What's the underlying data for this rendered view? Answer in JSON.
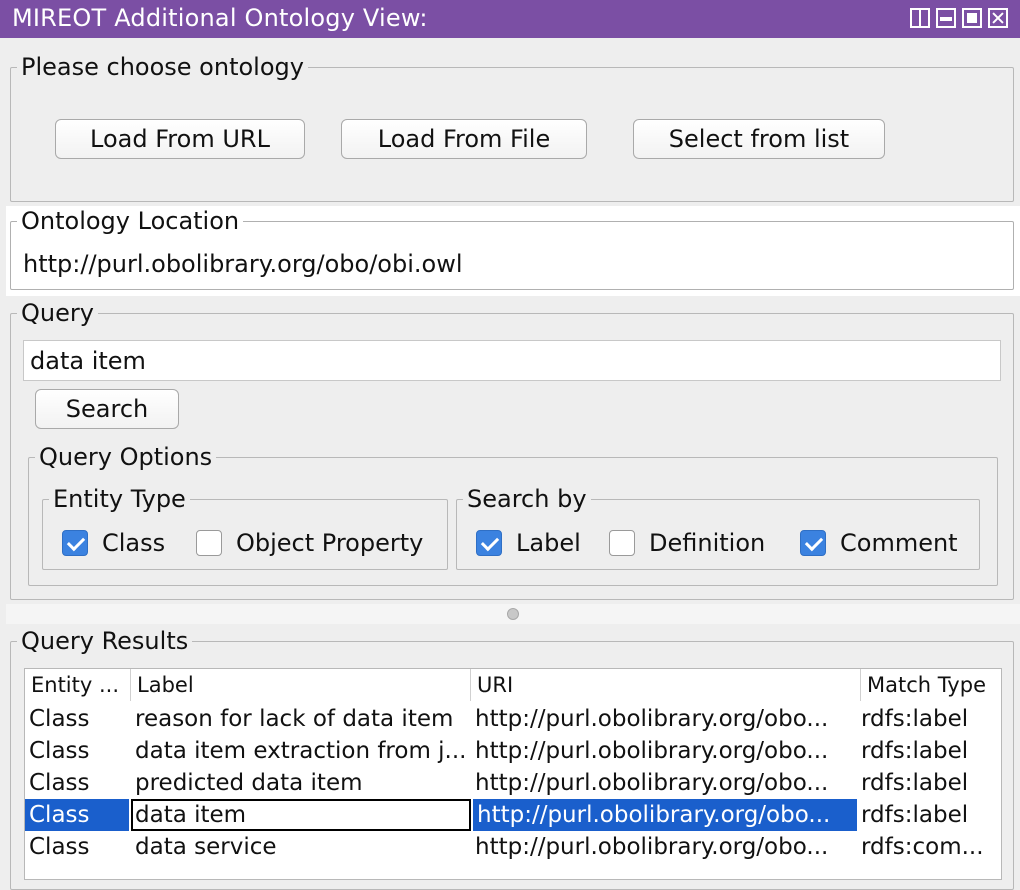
{
  "window": {
    "title": "MIREOT Additional Ontology View:",
    "controls": [
      "split-icon",
      "minimize-icon",
      "maximize-icon",
      "close-icon"
    ]
  },
  "choose": {
    "legend": "Please choose ontology",
    "buttons": [
      "Load From URL",
      "Load From File",
      "Select from list"
    ]
  },
  "location": {
    "legend": "Ontology Location",
    "value": "http://purl.obolibrary.org/obo/obi.owl"
  },
  "query": {
    "legend": "Query",
    "value": "data item",
    "search_label": "Search",
    "options_legend": "Query Options",
    "entity_type": {
      "legend": "Entity Type",
      "options": [
        {
          "label": "Class",
          "checked": true
        },
        {
          "label": "Object Property",
          "checked": false
        }
      ]
    },
    "search_by": {
      "legend": "Search by",
      "options": [
        {
          "label": "Label",
          "checked": true
        },
        {
          "label": "Definition",
          "checked": false
        },
        {
          "label": "Comment",
          "checked": true
        }
      ]
    }
  },
  "results": {
    "legend": "Query Results",
    "columns": [
      "Entity ...",
      "Label",
      "URI",
      "Match Type"
    ],
    "rows": [
      [
        "Class",
        "reason for lack of data item",
        "http://purl.obolibrary.org/obo...",
        "rdfs:label"
      ],
      [
        "Class",
        "data item extraction from j...",
        "http://purl.obolibrary.org/obo...",
        "rdfs:label"
      ],
      [
        "Class",
        "predicted data item",
        "http://purl.obolibrary.org/obo...",
        "rdfs:label"
      ],
      [
        "Class",
        "data item",
        "http://purl.obolibrary.org/obo...",
        "rdfs:label"
      ],
      [
        "Class",
        "data service",
        "http://purl.obolibrary.org/obo...",
        "rdfs:com..."
      ]
    ],
    "selected_row": 3
  },
  "colors": {
    "titlebar": "#7b4fa4",
    "selection": "#1a5fcc",
    "checkbox": "#3b82e0"
  }
}
